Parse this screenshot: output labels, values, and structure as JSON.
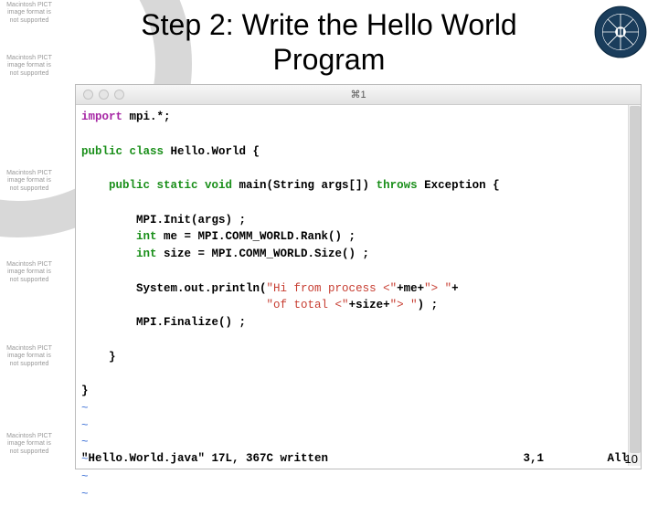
{
  "title_line1": "Step 2: Write the Hello World",
  "title_line2": "Program",
  "pict_placeholder": "Macintosh PICT image format is not supported",
  "window": {
    "title": "⌘1"
  },
  "code": {
    "l1_kw": "import",
    "l1_rest": " mpi.*;",
    "l2_kw": "public class",
    "l2_cls": " Hello.World {",
    "l3_a": "    public static void",
    "l3_b": " main(String args[]) ",
    "l3_c": "throws",
    "l3_d": " Exception {",
    "l4": "        MPI.Init(args) ;",
    "l5_a": "        int",
    "l5_b": " me = MPI.COMM_WORLD.Rank() ;",
    "l6_a": "        int",
    "l6_b": " size = MPI.COMM_WORLD.Size() ;",
    "l7_a": "        System.out.println(",
    "l7_s1": "\"Hi from process <\"",
    "l7_b": "+me+",
    "l7_s2": "\"> \"",
    "l7_c": "+",
    "l8_pad": "                           ",
    "l8_s1": "\"of total <\"",
    "l8_a": "+size+",
    "l8_s2": "\"> \"",
    "l8_b": ") ;",
    "l9": "        MPI.Finalize() ;",
    "l10": "    }",
    "l11": "}",
    "tilde": "~"
  },
  "status": {
    "msg": "\"Hello.World.java\" 17L, 367C written",
    "pos": "3,1",
    "all": "All"
  },
  "slide_num": "10"
}
